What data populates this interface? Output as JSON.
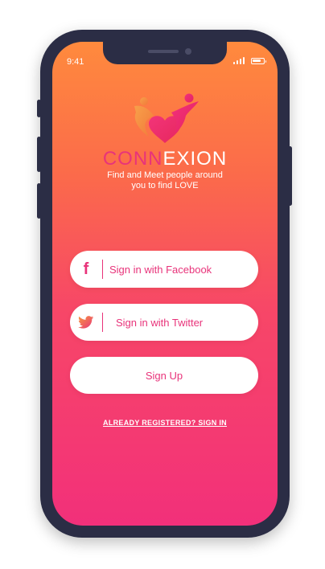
{
  "status_bar": {
    "time": "9:41"
  },
  "brand": {
    "part1": "CONN",
    "part2": "EXION",
    "tagline_line1": "Find and Meet people around",
    "tagline_line2": "you to find LOVE"
  },
  "buttons": {
    "facebook": "Sign in with Facebook",
    "twitter": "Sign in with Twitter",
    "signup": "Sign Up"
  },
  "already_registered": "ALREADY REGISTERED? SIGN IN",
  "colors": {
    "accent": "#e8337a",
    "gradient_top": "#ff8a3d",
    "gradient_bottom": "#f2307a",
    "frame": "#2b2d45"
  },
  "icons": {
    "logo": "heart-people-logo-icon",
    "facebook": "facebook-icon",
    "twitter": "twitter-bird-icon"
  }
}
